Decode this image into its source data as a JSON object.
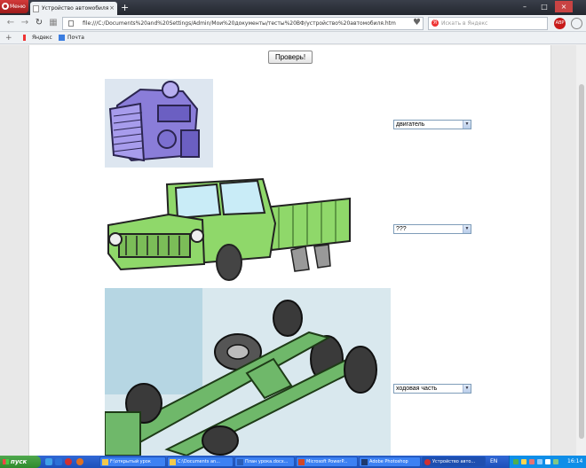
{
  "browser": {
    "menu_label": "Меню",
    "tab_title": "Устройство автомобиля",
    "address": "file:///C:/Documents%20and%20Settings/Admin/Мои%20документы/тесты%20ВФ/устройство%20автомобиля.htm",
    "search_placeholder": "Искать в Яндекс",
    "adblock_label": "ABP"
  },
  "bookmarks": [
    {
      "label": "Яндекс"
    },
    {
      "label": "Почта"
    }
  ],
  "page": {
    "check_button": "Проверь!",
    "selects": [
      {
        "value": "двигатель"
      },
      {
        "value": "???"
      },
      {
        "value": "ходовая часть"
      }
    ]
  },
  "taskbar": {
    "start_label": "пуск",
    "items": [
      {
        "label": "F:\\открытый урок"
      },
      {
        "label": "C:\\Documents an..."
      },
      {
        "label": "План урока.docx..."
      },
      {
        "label": "Microsoft PowerP..."
      },
      {
        "label": "Adobe Photoshop"
      },
      {
        "label": "Устройство авто..."
      }
    ],
    "language": "EN",
    "clock": "16:14"
  },
  "colors": {
    "accent": "#3168d5",
    "truck_body": "#8fd86a",
    "chassis": "#6fb86a",
    "engine": "#8a7dd9"
  }
}
